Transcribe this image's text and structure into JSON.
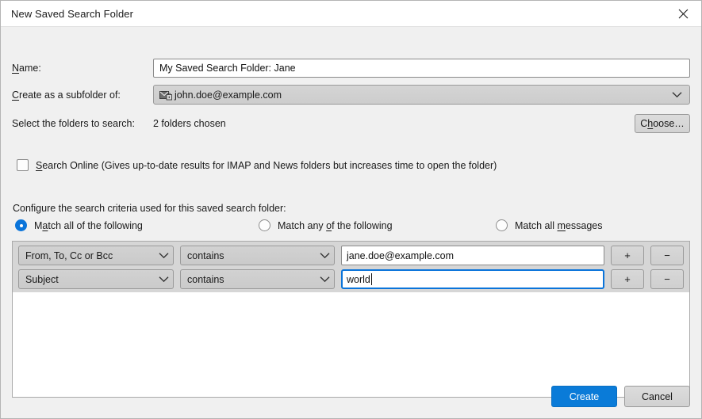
{
  "window": {
    "title": "New Saved Search Folder",
    "close_icon": "close-icon"
  },
  "form": {
    "name_label_pre": "N",
    "name_label_accesskey": "N",
    "name_label": "Name:",
    "name_value": "My Saved Search Folder: Jane",
    "subfolder_label": "Create as a subfolder of:",
    "subfolder_value": "john.doe@example.com",
    "subfolder_icon": "mail-account-locked-icon",
    "folders_label": "Select the folders to search:",
    "folders_value": "2 folders chosen",
    "choose_button": "Choose…"
  },
  "search_online": {
    "label": "Search Online (Gives up-to-date results for IMAP and News folders but increases time to open the folder)",
    "checked": false
  },
  "criteria": {
    "heading": "Configure the search criteria used for this saved search folder:",
    "match_options": [
      {
        "label": "Match all of the following",
        "selected": true
      },
      {
        "label": "Match any of the following",
        "selected": false
      },
      {
        "label": "Match all messages",
        "selected": false
      }
    ],
    "rows": [
      {
        "field": "From, To, Cc or Bcc",
        "operator": "contains",
        "value": "jane.doe@example.com",
        "focused": false,
        "add_label": "+",
        "remove_label": "−"
      },
      {
        "field": "Subject",
        "operator": "contains",
        "value": "world",
        "focused": true,
        "add_label": "+",
        "remove_label": "−"
      }
    ]
  },
  "footer": {
    "create_label": "Create",
    "cancel_label": "Cancel"
  },
  "colors": {
    "accent": "#0a7bd8",
    "radio_selected": "#0a74da",
    "focus_border": "#0a74da",
    "dialog_bg": "#f0f0f0",
    "titlebar_bg": "#ffffff"
  }
}
